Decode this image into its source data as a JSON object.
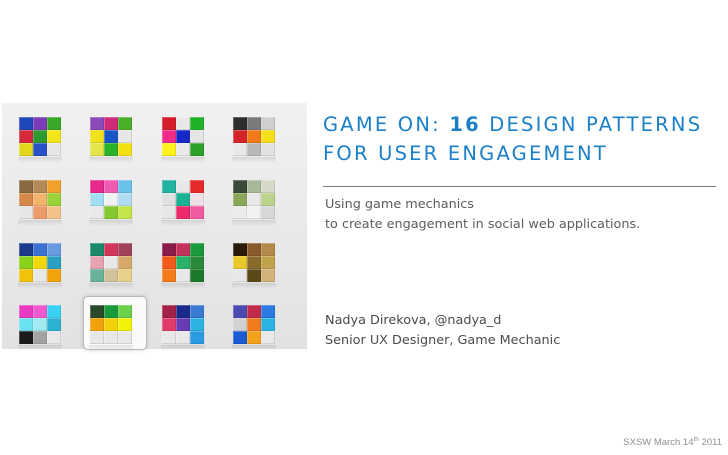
{
  "title": {
    "line1_prefix": "GAME ON: ",
    "line1_number": "16",
    "line1_suffix": " DESIGN PATTERNS",
    "line2": "FOR USER ENGAGEMENT"
  },
  "subtitle": {
    "line1": "Using game mechanics",
    "line2": "to create engagement in social web applications."
  },
  "author": {
    "line1": "Nadya Direkova, @nadya_d",
    "line2": "Senior UX Designer,  Game Mechanic"
  },
  "footer": {
    "prefix": "SXSW March 14",
    "superscript": "th",
    "suffix": " 2011"
  },
  "blocks": [
    {
      "colors": [
        "#1e47b8",
        "#7b3cb8",
        "#3aa62a",
        "#d8283c",
        "#2e9a32",
        "#f2e61a",
        "#e3d81e",
        "#2a52c8",
        "#e6e6e6"
      ]
    },
    {
      "colors": [
        "#8a4ab8",
        "#d02a7a",
        "#4ab02a",
        "#f1e21c",
        "#1b56c8",
        "#e6e6e6",
        "#e3e64a",
        "#2bb02a",
        "#f2e012"
      ]
    },
    {
      "colors": [
        "#d41c2c",
        "#e8e8e8",
        "#22b22a",
        "#ef2a88",
        "#1628c8",
        "#e4e4e4",
        "#fff21c",
        "#e9e9e9",
        "#2ba12a"
      ]
    },
    {
      "colors": [
        "#2e2e2e",
        "#7a7a7a",
        "#cfcfcf",
        "#d3242a",
        "#f07a18",
        "#f5df1a",
        "#e8e8e8",
        "#b8b8b8",
        "#e2e2e2"
      ]
    },
    {
      "colors": [
        "#8a6a40",
        "#b48a58",
        "#f2a02c",
        "#d58848",
        "#f2b46a",
        "#9ad23a",
        "#e6e6e6",
        "#ed9a6a",
        "#f2c28a"
      ]
    },
    {
      "colors": [
        "#e42a8a",
        "#f05ab2",
        "#6ac2ea",
        "#a0e0f2",
        "#f2f2f2",
        "#b2dcf2",
        "#e8e8e8",
        "#84c832",
        "#c2e64a"
      ]
    },
    {
      "colors": [
        "#22b2a2",
        "#e8e8e8",
        "#e42a2a",
        "#e0e0e0",
        "#1ab292",
        "#f2e0e8",
        "#e6e6e6",
        "#ed2a6a",
        "#f25aa0"
      ]
    },
    {
      "colors": [
        "#3a4a3a",
        "#a8b89a",
        "#d8d8c8",
        "#8aa85a",
        "#e8e8e8",
        "#bdd28a",
        "#ececec",
        "#f2f2f2",
        "#d8d8d8"
      ]
    },
    {
      "colors": [
        "#1c3a8a",
        "#3a72d2",
        "#6a9ae2",
        "#8ad21a",
        "#f2d80a",
        "#2aa0c2",
        "#f2c20a",
        "#e8e8e8",
        "#f2a20a"
      ]
    },
    {
      "colors": [
        "#1a8a6a",
        "#d2365a",
        "#a2425a",
        "#e8a2b2",
        "#e8e8e8",
        "#d8a86a",
        "#6ab29a",
        "#d2c29a",
        "#e8d08a"
      ]
    },
    {
      "colors": [
        "#8a1a4a",
        "#c2325a",
        "#1a9a3a",
        "#f25a1a",
        "#2ab26a",
        "#2a8a3a",
        "#f27a1a",
        "#e8e8e8",
        "#1a7a2a"
      ]
    },
    {
      "colors": [
        "#2a1a0a",
        "#8a5a2a",
        "#b28a4a",
        "#e8c82a",
        "#8a6a2a",
        "#c2a24a",
        "#e8e8e8",
        "#5a4a1a",
        "#d2b27a"
      ]
    },
    {
      "colors": [
        "#e83ac2",
        "#f25ad2",
        "#3ad2f2",
        "#6ae2f2",
        "#a2eaf2",
        "#2ab2d2",
        "#1a1a1a",
        "#a2a2a2",
        "#e8e8e8"
      ]
    },
    {
      "colors": [
        "#2a4a2a",
        "#1a9a3a",
        "#6ad24a",
        "#f2a20a",
        "#f2d20a",
        "#f2f20a",
        "#e8e8e8",
        "#e8e8e8",
        "#e8e8e8"
      ]
    },
    {
      "colors": [
        "#a2224a",
        "#1a2a8a",
        "#3a7ad2",
        "#e23a6a",
        "#6a3ab2",
        "#2ab2e2",
        "#e8e8e8",
        "#e8e8e8",
        "#2a9ae2"
      ]
    },
    {
      "colors": [
        "#4a4ab2",
        "#c22a4a",
        "#2a7ae2",
        "#d2d2d2",
        "#f27a1a",
        "#2ab2e2",
        "#1a5ad2",
        "#f2a21a",
        "#e8e8e8"
      ]
    }
  ]
}
